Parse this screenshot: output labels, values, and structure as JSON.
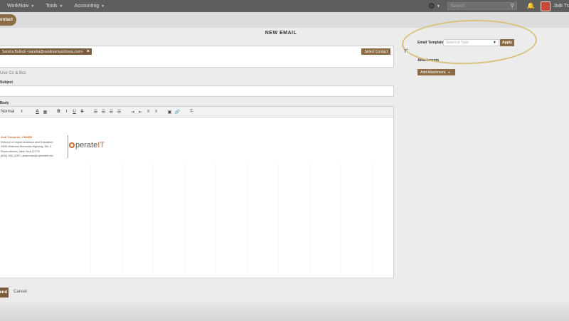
{
  "topnav": {
    "items": [
      {
        "label": "WorkNow"
      },
      {
        "label": "Tools"
      },
      {
        "label": "Accounting"
      }
    ],
    "search_placeholder": "Search",
    "user_name": "Jodi Tra"
  },
  "subbar": {
    "contact_label": "Contact"
  },
  "email": {
    "title": "NEW EMAIL",
    "recipient_chip": "Sandra Bullock <sandra@sandrasmusictress.com>",
    "select_contact_label": "Select Contact",
    "cc_link": "Use Cc & Bcc",
    "subject_label": "Subject",
    "body_label": "Body",
    "format_value": "Normal",
    "signature": {
      "name": "Jodi Tramonto, CMABE",
      "lines": [
        "Director of Implementation and Education",
        "2805 Veterans Memorial Highway, Ste 3",
        "Ronkonkoma, New York  11779",
        "(631) 625-2292  |  jtramonto@operateit.net"
      ],
      "logo_text": "perate",
      "logo_accent": "IT"
    },
    "send_label": "Send",
    "cancel_label": "Cancel"
  },
  "right_panel": {
    "template_label": "Email Template",
    "template_placeholder": "Select or Type",
    "apply_label": "Apply",
    "attachments_label": "Attachments",
    "add_attachment_label": "Add Attachment"
  },
  "colors": {
    "brand": "#8d6c45",
    "nav_bg": "#5e5e5e",
    "highlight": "#d7c17d",
    "signature_accent": "#d06a2a"
  }
}
